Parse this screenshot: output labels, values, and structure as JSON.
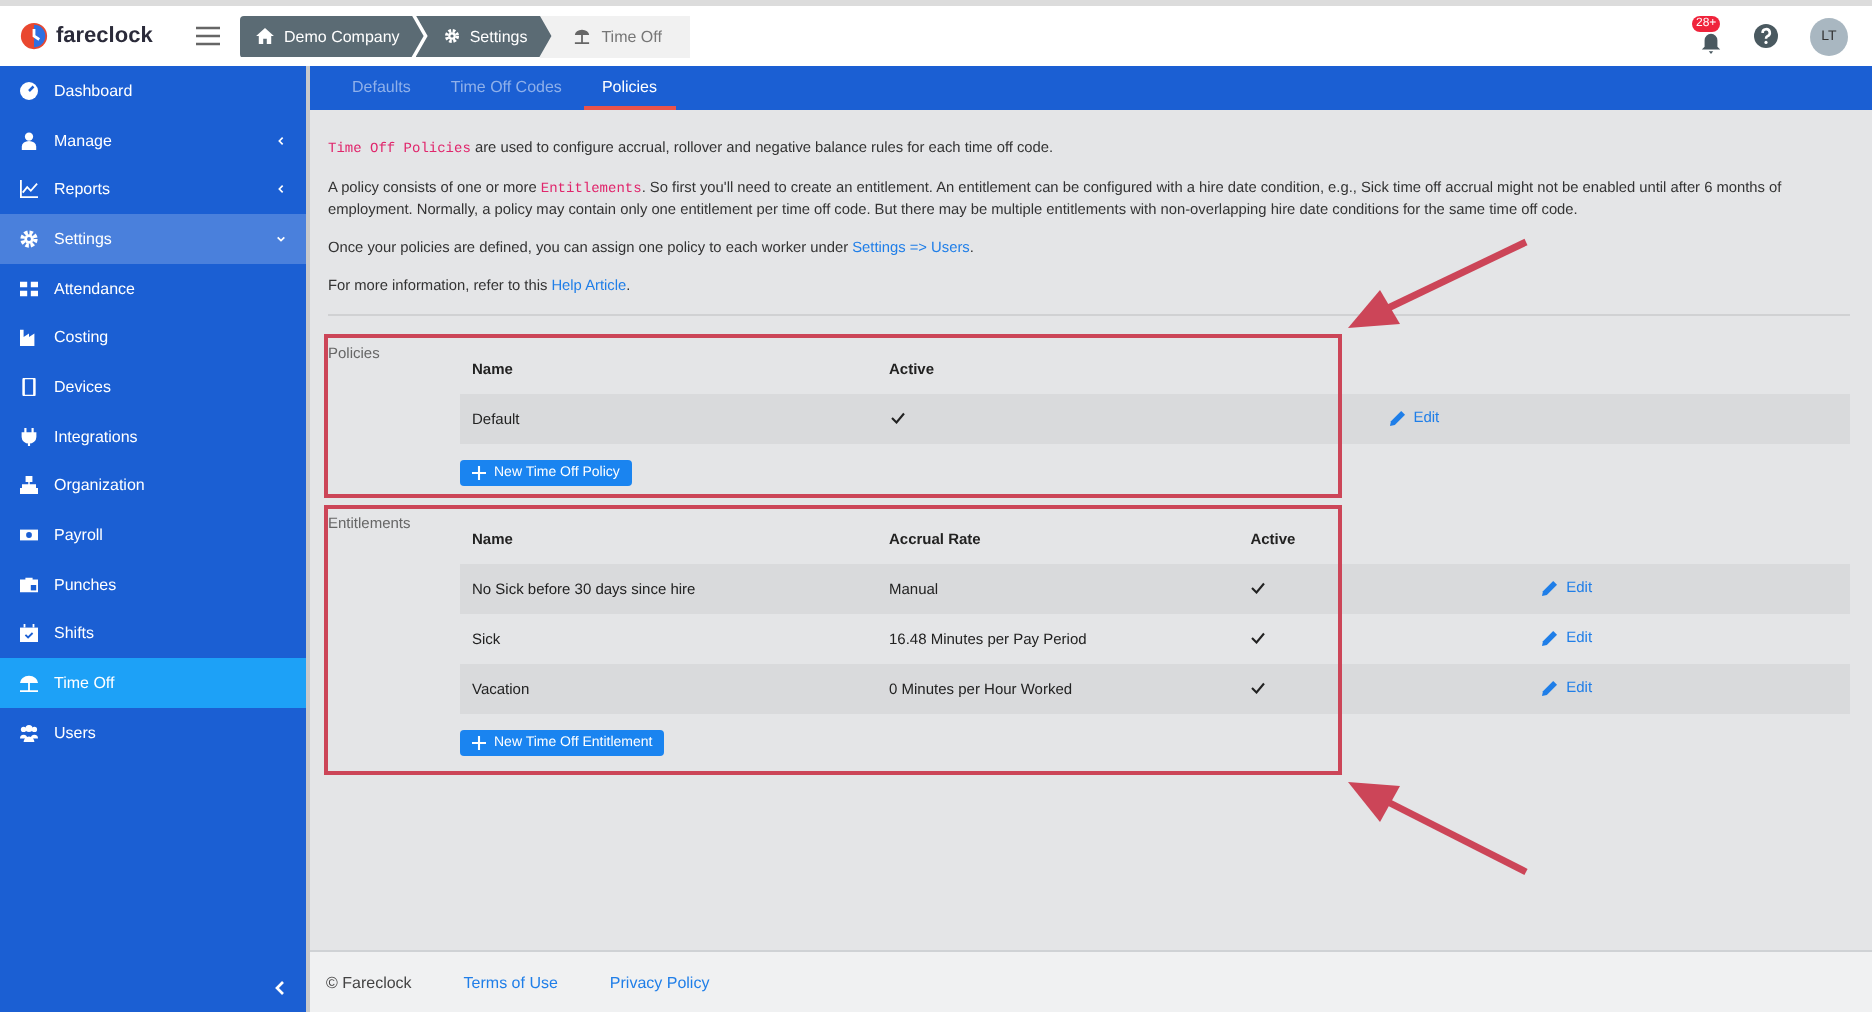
{
  "app": {
    "name": "fareclock"
  },
  "breadcrumbs": [
    {
      "label": "Demo Company",
      "current": false
    },
    {
      "label": "Settings",
      "current": false
    },
    {
      "label": "Time Off",
      "current": true
    }
  ],
  "header": {
    "notification_count": "28+",
    "avatar_initials": "LT"
  },
  "sidebar": {
    "items": [
      {
        "label": "Dashboard",
        "selected": false
      },
      {
        "label": "Manage",
        "selected": false,
        "expanded": false
      },
      {
        "label": "Reports",
        "selected": false,
        "expanded": false
      },
      {
        "label": "Settings",
        "selected": false,
        "expanded": true
      },
      {
        "label": "Attendance",
        "selected": false
      },
      {
        "label": "Costing",
        "selected": false
      },
      {
        "label": "Devices",
        "selected": false
      },
      {
        "label": "Integrations",
        "selected": false
      },
      {
        "label": "Organization",
        "selected": false
      },
      {
        "label": "Payroll",
        "selected": false
      },
      {
        "label": "Punches",
        "selected": false
      },
      {
        "label": "Shifts",
        "selected": false
      },
      {
        "label": "Time Off",
        "selected": true
      },
      {
        "label": "Users",
        "selected": false
      }
    ]
  },
  "tabs": [
    {
      "label": "Defaults",
      "selected": false
    },
    {
      "label": "Time Off Codes",
      "selected": false
    },
    {
      "label": "Policies",
      "selected": true
    }
  ],
  "intro": [
    [
      {
        "kind": "code",
        "text": "Time Off Policies"
      },
      {
        "kind": "plain",
        "text": " are used to configure accrual, rollover and negative balance rules for each time off code."
      }
    ],
    [
      {
        "kind": "plain",
        "text": "A policy consists of one or more "
      },
      {
        "kind": "code",
        "text": "Entitlements"
      },
      {
        "kind": "plain",
        "text": ". So first you'll need to create an entitlement. An entitlement can be configured with a hire date condition, e.g., Sick time off accrual might not be enabled until after 6 months of employment. Normally, a policy may contain only one entitlement per time off code. But there may be multiple entitlements with non-overlapping hire date conditions for the same time off code."
      }
    ],
    [
      {
        "kind": "plain",
        "text": "Once your policies are defined, you can assign one policy to each worker under "
      },
      {
        "kind": "link",
        "text": "Settings => Users"
      },
      {
        "kind": "plain",
        "text": "."
      }
    ],
    [
      {
        "kind": "plain",
        "text": "For more information, refer to this "
      },
      {
        "kind": "link",
        "text": "Help Article"
      },
      {
        "kind": "plain",
        "text": "."
      }
    ]
  ],
  "policies": {
    "title": "Policies",
    "columns": [
      "Name",
      "Active"
    ],
    "rows": [
      {
        "cells": [
          "Default"
        ],
        "active": true,
        "action": "Edit"
      }
    ],
    "button": "New Time Off Policy"
  },
  "entitlements": {
    "title": "Entitlements",
    "columns": [
      "Name",
      "Accrual Rate",
      "Active"
    ],
    "rows": [
      {
        "cells": [
          "No Sick before 30 days since hire",
          "Manual"
        ],
        "active": true,
        "action": "Edit"
      },
      {
        "cells": [
          "Sick",
          "16.48 Minutes per Pay Period"
        ],
        "active": true,
        "action": "Edit"
      },
      {
        "cells": [
          "Vacation",
          "0 Minutes per Hour Worked"
        ],
        "active": true,
        "action": "Edit"
      }
    ],
    "button": "New Time Off Entitlement"
  },
  "footer": {
    "copyright": "© Fareclock",
    "links": [
      "Terms of Use",
      "Privacy Policy"
    ]
  }
}
